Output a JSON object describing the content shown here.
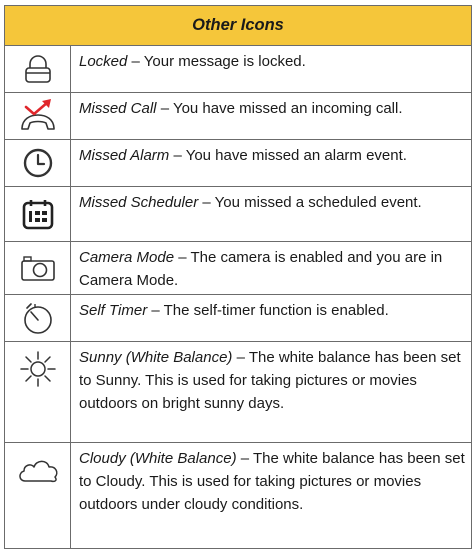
{
  "header": {
    "title": "Other Icons"
  },
  "rows": [
    {
      "icon": "lock-icon",
      "name": "Locked",
      "desc": " – Your message is locked."
    },
    {
      "icon": "missed-call-icon",
      "name": "Missed Call",
      "desc": " – You have missed an incoming call."
    },
    {
      "icon": "missed-alarm-icon",
      "name": "Missed Alarm",
      "desc": " – You have missed an alarm event."
    },
    {
      "icon": "missed-scheduler-icon",
      "name": "Missed Scheduler",
      "desc": " – You missed a scheduled event."
    },
    {
      "icon": "camera-icon",
      "name": "Camera Mode",
      "desc": " – The camera is enabled and you are in Camera Mode."
    },
    {
      "icon": "self-timer-icon",
      "name": "Self Timer",
      "desc": " – The self-timer function is enabled."
    },
    {
      "icon": "sunny-icon",
      "name": "Sunny (White Balance)",
      "desc": " – The white balance has been set to Sunny. This is used for taking pictures or movies outdoors on bright sunny days."
    },
    {
      "icon": "cloudy-icon",
      "name": "Cloudy (White Balance)",
      "desc": " – The white balance has been set to Cloudy. This is used for taking pictures or movies outdoors under cloudy conditions."
    }
  ],
  "colors": {
    "header_bg": "#f5c63a",
    "border": "#6b6b6b",
    "missed_red": "#e0262b"
  }
}
